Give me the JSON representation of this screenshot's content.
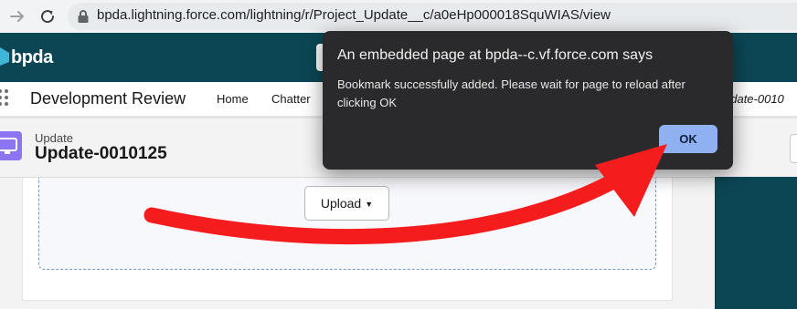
{
  "browser": {
    "url": "bpda.lightning.force.com/lightning/r/Project_Update__c/a0eHp000018SquWIAS/view",
    "icons": [
      "forward-arrow-icon",
      "reload-icon",
      "lock-icon"
    ]
  },
  "header": {
    "logo_text": "bpda"
  },
  "app_nav": {
    "app_name": "Development Review",
    "items": [
      "Home",
      "Chatter"
    ],
    "open_tab_partial": "pdate-0010"
  },
  "record": {
    "object_type": "Update",
    "title": "Update-0010125"
  },
  "content": {
    "upload_label": "Upload"
  },
  "dialog": {
    "title": "An embedded page at bpda--c.vf.force.com says",
    "message": "Bookmark successfully added. Please wait for page to reload after clicking OK",
    "ok_label": "OK"
  },
  "annotation": {
    "arrow_color": "#f41c1c"
  },
  "colors": {
    "header_bg": "#0c4654",
    "dialog_bg": "#2a2a2c",
    "ok_button": "#8fb1f2",
    "record_icon": "#8d74f0"
  }
}
